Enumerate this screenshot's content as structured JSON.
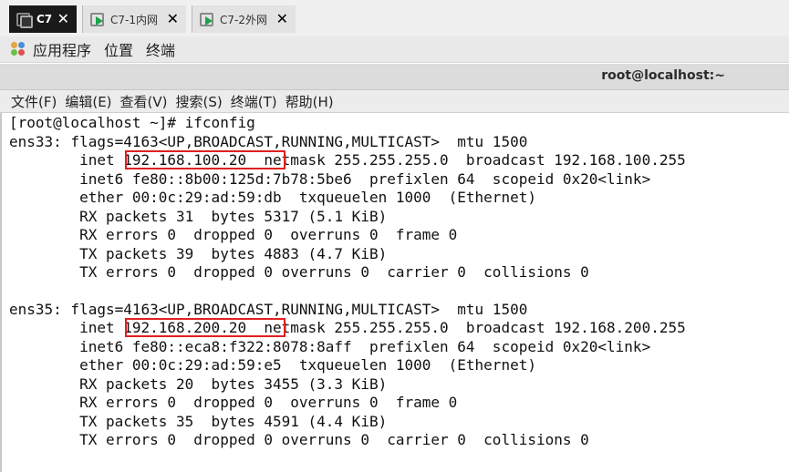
{
  "tabs": [
    {
      "label": "C7",
      "close": "✕",
      "active": true
    },
    {
      "label": "C7-1内网",
      "close": "✕",
      "active": false
    },
    {
      "label": "C7-2外网",
      "close": "✕",
      "active": false
    }
  ],
  "gnome_bar": {
    "applications": "应用程序",
    "places": "位置",
    "terminal": "终端"
  },
  "window": {
    "title": "root@localhost:~"
  },
  "menubar": {
    "file": "文件(F)",
    "edit": "编辑(E)",
    "view": "查看(V)",
    "search": "搜索(S)",
    "terminal": "终端(T)",
    "help": "帮助(H)"
  },
  "terminal": {
    "lines": [
      "[root@localhost ~]# ifconfig",
      "ens33: flags=4163<UP,BROADCAST,RUNNING,MULTICAST>  mtu 1500",
      "        inet 192.168.100.20  netmask 255.255.255.0  broadcast 192.168.100.255",
      "        inet6 fe80::8b00:125d:7b78:5be6  prefixlen 64  scopeid 0x20<link>",
      "        ether 00:0c:29:ad:59:db  txqueuelen 1000  (Ethernet)",
      "        RX packets 31  bytes 5317 (5.1 KiB)",
      "        RX errors 0  dropped 0  overruns 0  frame 0",
      "        TX packets 39  bytes 4883 (4.7 KiB)",
      "        TX errors 0  dropped 0 overruns 0  carrier 0  collisions 0",
      "",
      "ens35: flags=4163<UP,BROADCAST,RUNNING,MULTICAST>  mtu 1500",
      "        inet 192.168.200.20  netmask 255.255.255.0  broadcast 192.168.200.255",
      "        inet6 fe80::eca8:f322:8078:8aff  prefixlen 64  scopeid 0x20<link>",
      "        ether 00:0c:29:ad:59:e5  txqueuelen 1000  (Ethernet)",
      "        RX packets 20  bytes 3455 (3.3 KiB)",
      "        RX errors 0  dropped 0  overruns 0  frame 0",
      "        TX packets 35  bytes 4591 (4.4 KiB)",
      "        TX errors 0  dropped 0 overruns 0  carrier 0  collisions 0"
    ],
    "highlight_color": "#e02020"
  }
}
